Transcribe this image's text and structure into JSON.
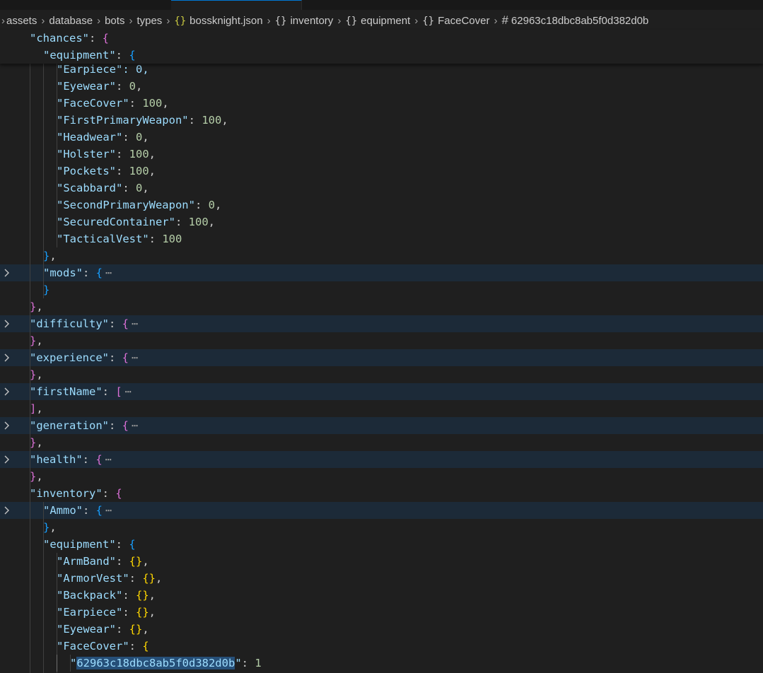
{
  "breadcrumb": {
    "items": [
      {
        "icon": "",
        "label": "assets"
      },
      {
        "icon": "",
        "label": "database"
      },
      {
        "icon": "",
        "label": "bots"
      },
      {
        "icon": "",
        "label": "types"
      },
      {
        "icon": "json-braces-icon",
        "label": "bossknight.json"
      },
      {
        "icon": "object-braces-icon",
        "label": "inventory"
      },
      {
        "icon": "object-braces-icon",
        "label": "equipment"
      },
      {
        "icon": "object-braces-icon",
        "label": "FaceCover"
      },
      {
        "icon": "hash-icon",
        "label": "62963c18dbc8ab5f0d382d0b"
      }
    ]
  },
  "sticky": {
    "chances_key": "\"chances\"",
    "equipment_key": "\"equipment\""
  },
  "editor": {
    "partial_top_line": "\"Earpiece\": 0,",
    "chances_equipment": [
      {
        "key": "\"Eyewear\"",
        "value": "0",
        "comma": ","
      },
      {
        "key": "\"FaceCover\"",
        "value": "100",
        "comma": ","
      },
      {
        "key": "\"FirstPrimaryWeapon\"",
        "value": "100",
        "comma": ","
      },
      {
        "key": "\"Headwear\"",
        "value": "0",
        "comma": ","
      },
      {
        "key": "\"Holster\"",
        "value": "100",
        "comma": ","
      },
      {
        "key": "\"Pockets\"",
        "value": "100",
        "comma": ","
      },
      {
        "key": "\"Scabbard\"",
        "value": "0",
        "comma": ","
      },
      {
        "key": "\"SecondPrimaryWeapon\"",
        "value": "0",
        "comma": ","
      },
      {
        "key": "\"SecuredContainer\"",
        "value": "100",
        "comma": ","
      },
      {
        "key": "\"TacticalVest\"",
        "value": "100",
        "comma": ""
      }
    ],
    "mods_key": "\"mods\"",
    "folded_sections": [
      {
        "key": "\"difficulty\"",
        "open": "{",
        "close": "},"
      },
      {
        "key": "\"experience\"",
        "open": "{",
        "close": "},"
      },
      {
        "key": "\"firstName\"",
        "open": "[",
        "close": "],"
      },
      {
        "key": "\"generation\"",
        "open": "{",
        "close": "},"
      },
      {
        "key": "\"health\"",
        "open": "{",
        "close": "},"
      }
    ],
    "inventory_key": "\"inventory\"",
    "ammo_key": "\"Ammo\"",
    "inv_equipment_key": "\"equipment\"",
    "inv_equipment": [
      {
        "key": "\"ArmBand\""
      },
      {
        "key": "\"ArmorVest\""
      },
      {
        "key": "\"Backpack\""
      },
      {
        "key": "\"Earpiece\""
      },
      {
        "key": "\"Eyewear\""
      }
    ],
    "facecover_key": "\"FaceCover\"",
    "facecover_entry": {
      "id": "62963c18dbc8ab5f0d382d0b",
      "value": "1"
    },
    "ellipsis": "⋯"
  },
  "colors": {
    "background": "#1f1f1f",
    "key": "#9cdcfe",
    "string": "#ce9178",
    "number": "#b5cea8",
    "bracket_gold": "#ffd700",
    "bracket_orchid": "#da70d6",
    "bracket_blue": "#179fff",
    "fold_highlight": "#1c2a38",
    "selection": "#264f78"
  }
}
